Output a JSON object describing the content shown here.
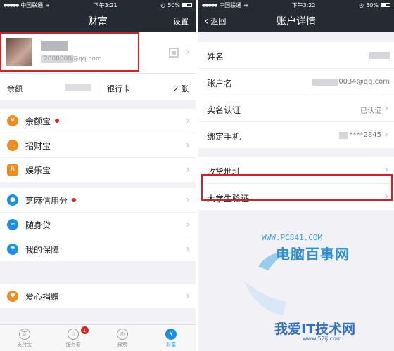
{
  "left": {
    "status": {
      "carrier": "中国联通",
      "time": "下午3:21",
      "battery": "50%"
    },
    "nav": {
      "title": "财富",
      "right": "设置"
    },
    "profile": {
      "email": "2000000@qq.com"
    },
    "balance": {
      "label": "余额",
      "bank_label": "银行卡",
      "bank_count": "2 张"
    },
    "items": [
      {
        "label": "余额宝",
        "icon": "yuebao-icon",
        "color": "#f08a1c",
        "dot": true
      },
      {
        "label": "招财宝",
        "icon": "zhaocaibao-icon",
        "color": "#f08a1c",
        "dot": false
      },
      {
        "label": "娱乐宝",
        "icon": "yulebao-icon",
        "color": "#f08a1c",
        "dot": false
      },
      {
        "label": "芝麻信用分",
        "icon": "sesame-credit-icon",
        "color": "#1a8fe3",
        "dot": true
      },
      {
        "label": "随身贷",
        "icon": "loan-icon",
        "color": "#1a8fe3",
        "dot": false
      },
      {
        "label": "我的保障",
        "icon": "umbrella-icon",
        "color": "#1a8fe3",
        "dot": false
      },
      {
        "label": "爱心捐赠",
        "icon": "heart-icon",
        "color": "#f08a1c",
        "dot": false
      }
    ],
    "tabs": [
      {
        "label": "支付宝",
        "icon": "alipay-icon"
      },
      {
        "label": "服务窗",
        "icon": "service-window-icon",
        "badge": "1"
      },
      {
        "label": "探索",
        "icon": "explore-icon"
      },
      {
        "label": "财富",
        "icon": "wealth-icon",
        "active": true
      }
    ]
  },
  "right": {
    "status": {
      "carrier": "中国联通",
      "time": "下午3:22",
      "battery": "50%"
    },
    "nav": {
      "title": "账户详情",
      "back": "返回"
    },
    "rows": [
      {
        "label": "姓名",
        "value": ""
      },
      {
        "label": "账户名",
        "value": "0034@qq.com"
      },
      {
        "label": "实名认证",
        "value": "已认证"
      },
      {
        "label": "绑定手机",
        "value": "****2845"
      },
      {
        "label": "收货地址",
        "value": ""
      },
      {
        "label": "大学生验证",
        "value": ""
      }
    ]
  },
  "watermark": {
    "url": "WWW.PC841.COM",
    "title": "电脑百事网",
    "title2": "我爱IT技术网",
    "url2": "www.52ij.com"
  },
  "colors": {
    "highlight": "#e21a24",
    "navbar": "#262a33",
    "accent": "#1a8fe3"
  }
}
